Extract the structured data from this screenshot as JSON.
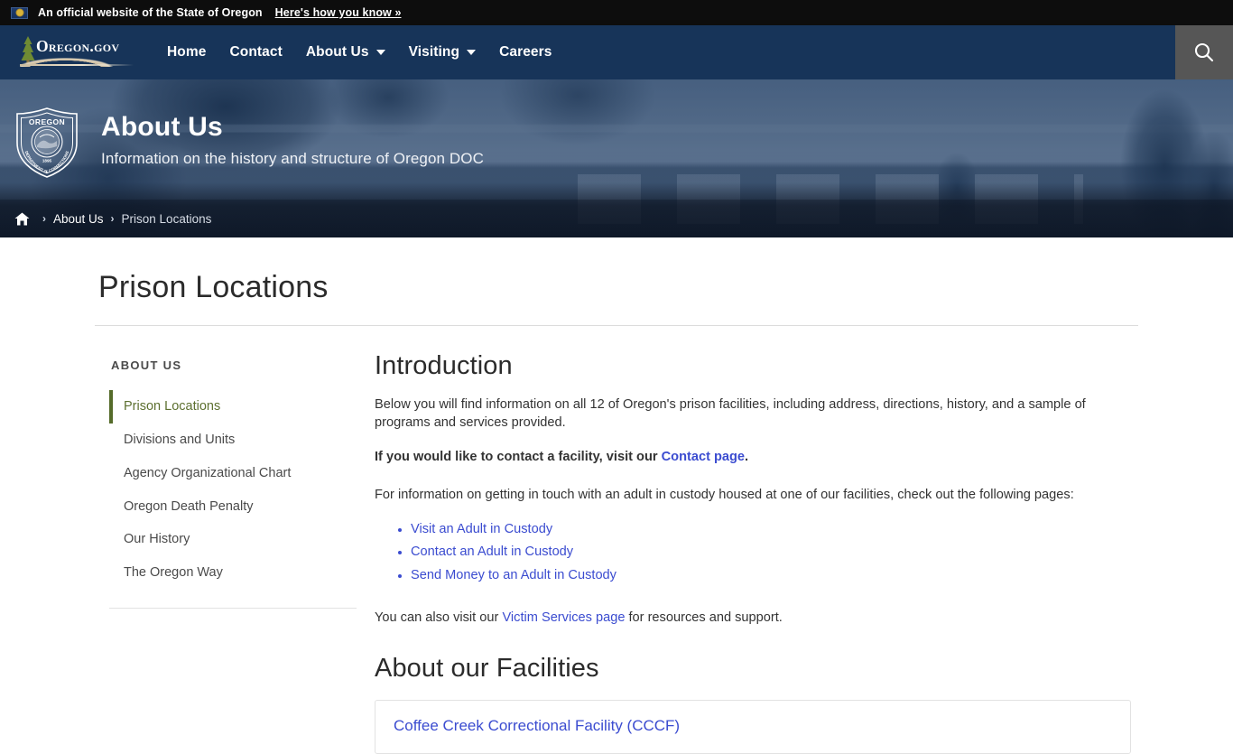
{
  "gov_bar": {
    "notice": "An official website of the State of Oregon",
    "how_you_know": "Here's how you know »",
    "flag_icon": "oregon-flag-icon"
  },
  "navbar": {
    "brand": "Oregon.gov",
    "items": [
      {
        "label": "Home",
        "has_dropdown": false
      },
      {
        "label": "Contact",
        "has_dropdown": false
      },
      {
        "label": "About Us",
        "has_dropdown": true
      },
      {
        "label": "Visiting",
        "has_dropdown": true
      },
      {
        "label": "Careers",
        "has_dropdown": false
      }
    ],
    "search_icon": "search-icon",
    "colors": {
      "navy": "#173459",
      "search_bg": "#565656"
    }
  },
  "hero": {
    "badge_alt": "Oregon Department of Corrections seal",
    "badge_top_text": "OREGON",
    "badge_ring_text": "DEPARTMENT OF CORRECTIONS",
    "badge_year": "1895",
    "title": "About Us",
    "subtitle": "Information on the history and structure of Oregon DOC"
  },
  "breadcrumb": {
    "home_icon": "home-icon",
    "separator": "›",
    "items": [
      {
        "label": "About Us",
        "current": false
      },
      {
        "label": "Prison Locations",
        "current": true
      }
    ]
  },
  "page": {
    "title": "Prison Locations"
  },
  "sidebar": {
    "heading": "ABOUT US",
    "items": [
      {
        "label": "Prison Locations",
        "active": true
      },
      {
        "label": "Divisions and Units",
        "active": false
      },
      {
        "label": "Agency Organizational Chart",
        "active": false
      },
      {
        "label": "Oregon Death Penalty",
        "active": false
      },
      {
        "label": "Our History",
        "active": false
      },
      {
        "label": "The Oregon Way",
        "active": false
      }
    ],
    "accent_color": "#556b2a"
  },
  "content": {
    "intro_heading": "Introduction",
    "intro_paragraph": "Below you will find information on all 12 of Oregon's prison facilities, including address, directions, history, and a sample of programs and services provided.",
    "contact_line_prefix": "If you would like to contact a facility, visit our ",
    "contact_link": "Contact page",
    "contact_line_suffix": ".",
    "getting_in_touch": "For information on getting in touch with an adult in custody housed at one of our facilities, check out the following pages:",
    "custody_links": [
      "Visit an Adult in Custody",
      "Contact an Adult in Custody",
      "Send Money to an Adult in Custody"
    ],
    "victim_prefix": "You can also visit our ",
    "victim_link": "Victim Services page",
    "victim_suffix": " for resources and support.",
    "facilities_heading": "About our Facilities",
    "first_facility": "Coffee Creek Correctional Facility (CCCF)",
    "link_color": "#3b4cd0"
  }
}
